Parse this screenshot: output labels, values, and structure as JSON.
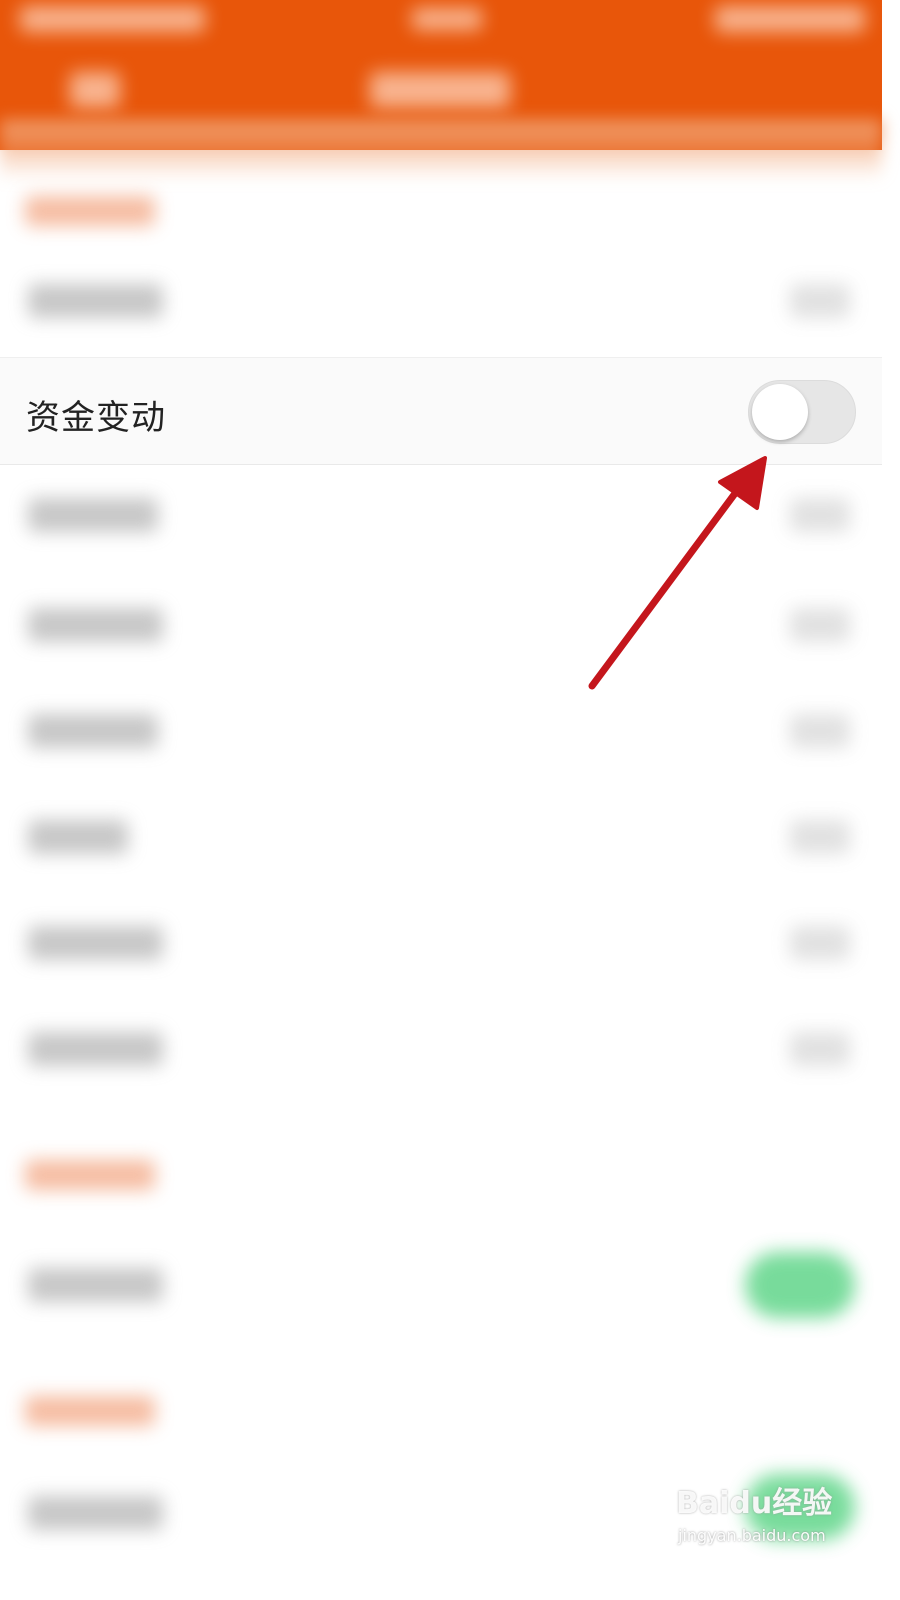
{
  "header": {
    "background": "#e8560a"
  },
  "setting": {
    "label": "资金变动",
    "toggle_on": false
  },
  "annotation": {
    "arrow_color": "#c4161c"
  },
  "watermark": {
    "main": "Baidu经验",
    "sub": "jingyan.baidu.com"
  }
}
